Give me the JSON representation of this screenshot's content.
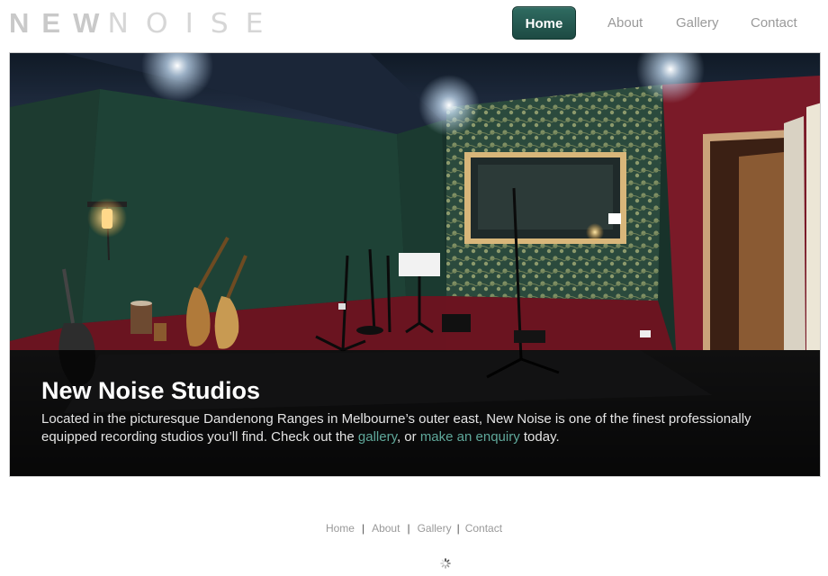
{
  "logo": {
    "text_bold": "NEW",
    "text_thin": "NOISE"
  },
  "nav": {
    "home": "Home",
    "about": "About",
    "gallery": "Gallery",
    "contact": "Contact"
  },
  "hero": {
    "title": "New Noise Studios",
    "text_before": "Located in the picturesque Dandenong Ranges in Melbourne’s outer east, New Noise is one of the finest professionally equipped recording studios you’ll find. Check out the ",
    "link_gallery": "gallery",
    "text_middle": ", or ",
    "link_enquiry": "make an enquiry",
    "text_after": " today."
  },
  "footer": {
    "home": "Home",
    "about": "About",
    "gallery": "Gallery",
    "contact": "Contact",
    "separator": "|"
  },
  "colors": {
    "accent": "#1f4f47",
    "link": "#5fa89b",
    "wall_red": "#6b1420",
    "wall_green": "#1f3a2f"
  },
  "icons": {
    "footer_small": "loading-spinner-icon"
  }
}
